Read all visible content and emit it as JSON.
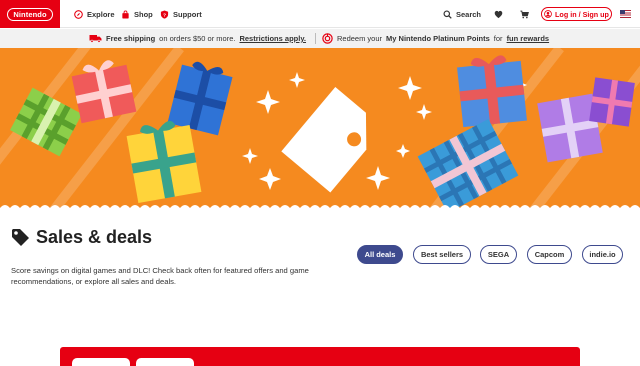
{
  "nav": {
    "logo": "Nintendo",
    "explore": "Explore",
    "shop": "Shop",
    "support": "Support",
    "search": "Search",
    "login": "Log in / Sign up"
  },
  "promo": {
    "left_bold": "Free shipping",
    "left_text": "on orders $50 or more.",
    "left_link": "Restrictions apply.",
    "right_text_1": "Redeem your",
    "right_bold": "My Nintendo Platinum Points",
    "right_text_2": "for",
    "right_link": "fun rewards"
  },
  "page": {
    "title": "Sales & deals",
    "description": "Score savings on digital games and DLC! Check back often for featured offers and game recommendations, or explore all sales and deals."
  },
  "filters": [
    "All deals",
    "Best sellers",
    "SEGA",
    "Capcom",
    "indie.io"
  ],
  "colors": {
    "brand_red": "#e60012",
    "hero_orange": "#f58a1f",
    "chip_navy": "#3e4a8e"
  }
}
